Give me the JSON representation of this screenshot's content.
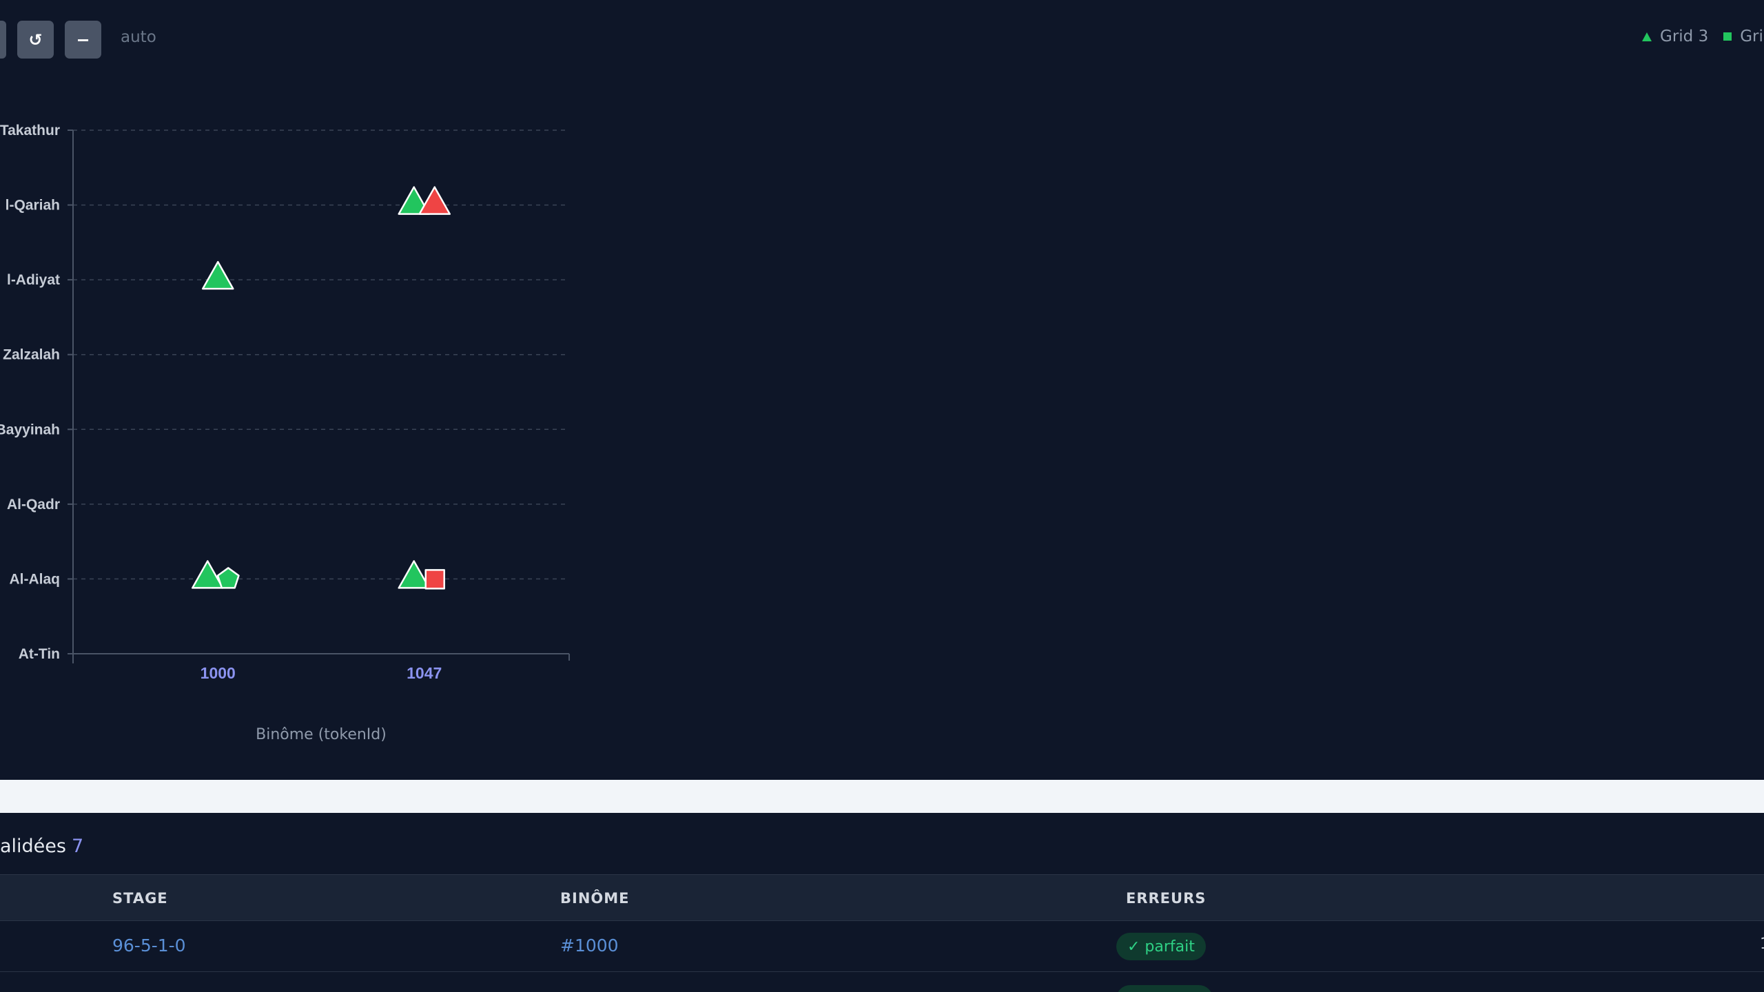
{
  "toolbar": {
    "reset_icon_glyph": "↺",
    "zoom_out_glyph": "−",
    "zoom_label": "auto"
  },
  "legend": {
    "items": [
      {
        "label": "Grid 3",
        "shape": "triangle",
        "color": "#22c55e"
      },
      {
        "label": "Grid",
        "shape": "square",
        "color": "#22c55e"
      }
    ]
  },
  "colors": {
    "green": "#22c55e",
    "red": "#ef4444",
    "accent": "#8b93f0",
    "link": "#5a8fd6"
  },
  "chart_data": {
    "type": "scatter",
    "xlabel": "Binôme (tokenId)",
    "x_ticks": [
      1000,
      1047
    ],
    "xlim": [
      967,
      1080
    ],
    "y_categories": [
      "Takathur",
      "Al-Qariah",
      "Al-Adiyat",
      "Zalzalah",
      "Bayyinah",
      "Al-Qadr",
      "Al-Alaq",
      "At-Tin"
    ],
    "y_display_labels": [
      "Takathur",
      "l-Qariah",
      "l-Adiyat",
      "Zalzalah",
      "Bayyinah",
      "Al-Qadr",
      "Al-Alaq",
      "At-Tin"
    ],
    "points": [
      {
        "x": 1047,
        "y": "Al-Qariah",
        "shape": "triangle",
        "color": "#22c55e",
        "offset": -1
      },
      {
        "x": 1047,
        "y": "Al-Qariah",
        "shape": "triangle",
        "color": "#ef4444",
        "offset": 1
      },
      {
        "x": 1000,
        "y": "Al-Adiyat",
        "shape": "triangle",
        "color": "#22c55e",
        "offset": 0
      },
      {
        "x": 1000,
        "y": "Al-Alaq",
        "shape": "triangle",
        "color": "#22c55e",
        "offset": -1
      },
      {
        "x": 1000,
        "y": "Al-Alaq",
        "shape": "pentagon",
        "color": "#22c55e",
        "offset": 1
      },
      {
        "x": 1047,
        "y": "Al-Alaq",
        "shape": "triangle",
        "color": "#22c55e",
        "offset": -1
      },
      {
        "x": 1047,
        "y": "Al-Alaq",
        "shape": "square",
        "color": "#ef4444",
        "offset": 1
      }
    ],
    "grid": true
  },
  "section": {
    "title": "alidées",
    "count": "7"
  },
  "table": {
    "columns": [
      "STAGE",
      "BINÔME",
      "ERREURS"
    ],
    "rows": [
      {
        "stage": "96-5-1-0",
        "binome": "#1000",
        "erreurs": "✓ parfait"
      }
    ]
  }
}
